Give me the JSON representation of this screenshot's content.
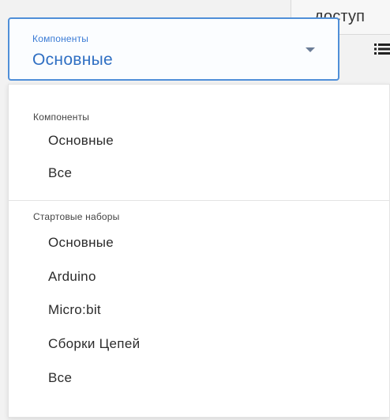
{
  "access_label": "доступ",
  "select": {
    "label": "Компоненты",
    "value": "Основные"
  },
  "menu": {
    "groups": [
      {
        "title": "Компоненты",
        "items": [
          "Основные",
          "Все"
        ]
      },
      {
        "title": "Стартовые наборы",
        "items": [
          "Основные",
          "Arduino",
          "Micro:bit",
          "Сборки Цепей",
          "Все"
        ]
      }
    ]
  },
  "colors": {
    "accent": "#4f8fd8",
    "accent_text": "#2f6fc3"
  },
  "icons": {
    "caret": "caret-down-icon",
    "list": "list-view-icon"
  }
}
